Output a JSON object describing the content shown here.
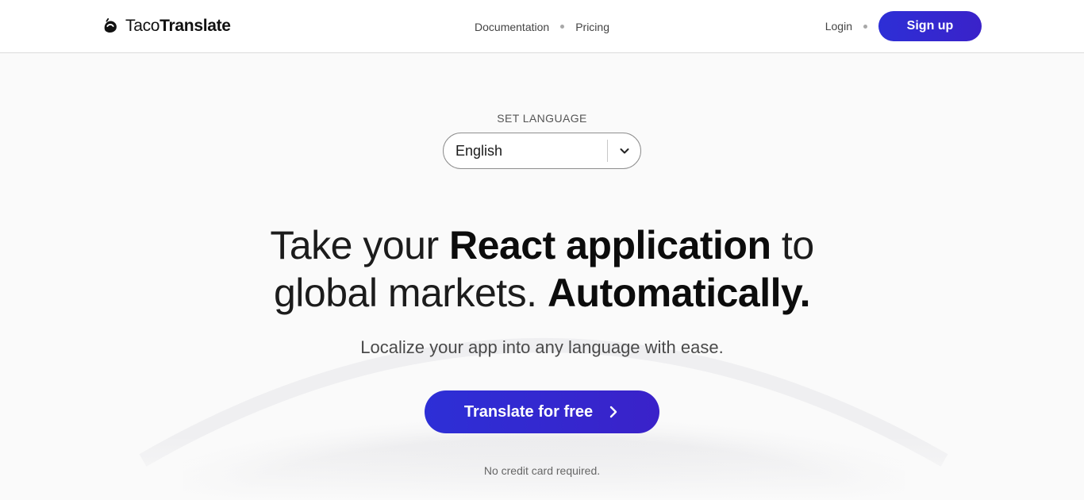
{
  "header": {
    "logo": {
      "light": "Taco",
      "bold": "Translate"
    },
    "nav": [
      {
        "label": "Documentation"
      },
      {
        "label": "Pricing"
      }
    ],
    "login_label": "Login",
    "signup_label": "Sign up"
  },
  "language": {
    "label": "SET LANGUAGE",
    "selected": "English"
  },
  "hero": {
    "line1_a": "Take your ",
    "line1_b": "React application",
    "line1_c": " to",
    "line2_a": "global markets. ",
    "line2_b": "Automatically.",
    "subtitle": "Localize your app into any language with ease.",
    "cta_label": "Translate for free",
    "note": "No credit card required."
  },
  "colors": {
    "accent": "#2d2fd6",
    "accent_end": "#3a22c9"
  }
}
